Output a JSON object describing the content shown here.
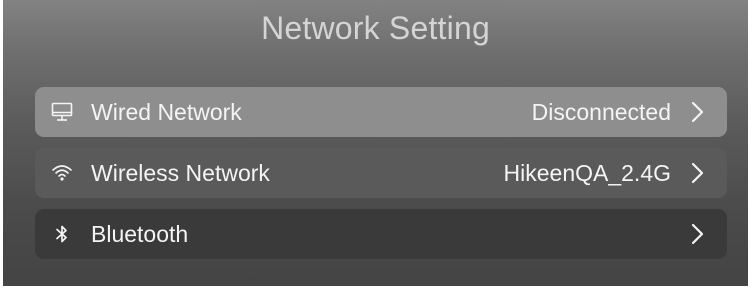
{
  "header": {
    "title": "Network Setting"
  },
  "settings": {
    "items": [
      {
        "label": "Wired Network",
        "value": "Disconnected",
        "icon": "monitor-icon"
      },
      {
        "label": "Wireless Network",
        "value": "HikeenQA_2.4G",
        "icon": "wifi-icon"
      },
      {
        "label": "Bluetooth",
        "value": "",
        "icon": "bluetooth-icon"
      }
    ]
  },
  "colors": {
    "row_selected": "#8e8e8e",
    "row_middle": "#5a5a5a",
    "row_dark": "#3a3a3a",
    "text": "#f4f4f4",
    "title": "#d4d4d4"
  }
}
